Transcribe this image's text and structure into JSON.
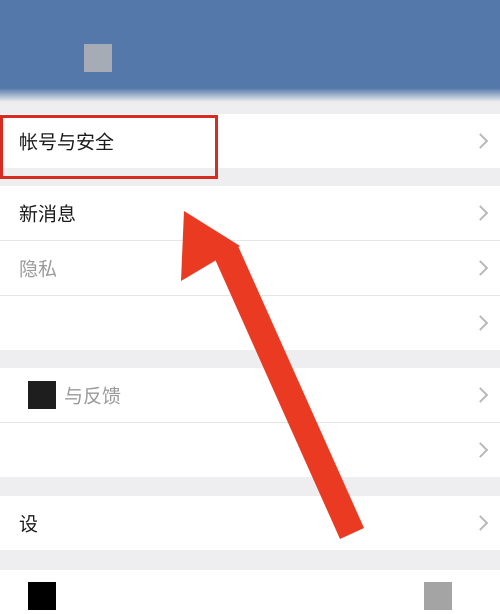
{
  "header": {
    "avatar_icon": "square-avatar-icon",
    "background_color": "#5478a9"
  },
  "settings": {
    "group1": {
      "items": [
        {
          "label": "帐号与安全"
        }
      ]
    },
    "group2": {
      "items": [
        {
          "label": "新消息"
        },
        {
          "label": "隐私"
        },
        {
          "label": ""
        }
      ]
    },
    "group3": {
      "items": [
        {
          "label": "与反馈"
        },
        {
          "label": ""
        }
      ]
    },
    "group4": {
      "items": [
        {
          "label": "设"
        }
      ]
    }
  },
  "annotation": {
    "highlight_color": "#d62d20",
    "arrow_color": "#ea3a22"
  }
}
